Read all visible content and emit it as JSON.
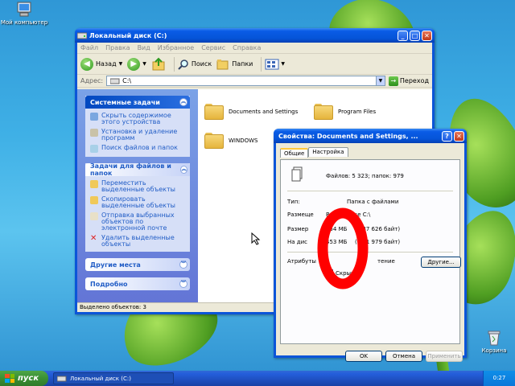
{
  "desktop": {
    "my_computer_label": "Мой компьютер",
    "recycle_bin_label": "Корзина"
  },
  "explorer": {
    "title": "Локальный диск (C:)",
    "menu": [
      "Файл",
      "Правка",
      "Вид",
      "Избранное",
      "Сервис",
      "Справка"
    ],
    "toolbar": {
      "back": "Назад",
      "search": "Поиск",
      "folders": "Папки"
    },
    "address_label": "Адрес:",
    "address_value": "C:\\",
    "go_label": "Переход",
    "system_tasks": {
      "title": "Системные задачи",
      "items": [
        "Скрыть содержимое этого устройства",
        "Установка и удаление программ",
        "Поиск файлов и папок"
      ]
    },
    "file_tasks": {
      "title": "Задачи для файлов и папок",
      "items": [
        "Переместить выделенные объекты",
        "Скопировать выделенные объекты",
        "Отправка выбранных объектов по электронной почте",
        "Удалить выделенные объекты"
      ]
    },
    "other_places": "Другие места",
    "details": "Подробно",
    "folders": [
      "Documents and Settings",
      "Program Files",
      "WINDOWS"
    ],
    "status": "Выделено объектов: 3"
  },
  "dialog": {
    "title": "Свойства: Documents and Settings, ...",
    "tabs": [
      "Общие",
      "Настройка"
    ],
    "files_summary": "Файлов: 5 323; папок: 979",
    "type_label": "Тип:",
    "type_value": "Папка с файлами",
    "location_label": "Размеще",
    "location_value": "Все в папке C:\\",
    "size_label": "Размер",
    "size_value": "454 МБ",
    "size_bytes": "(   787 626 байт)",
    "disk_label": "На дис",
    "disk_value": "453 МБ",
    "disk_bytes": "(   781 979 байт)",
    "attributes_label": "Атрибуты",
    "readonly_label": "тение",
    "hidden_label": "Скрытый",
    "other_button": "Другие...",
    "ok": "OK",
    "cancel": "Отмена",
    "apply": "Применить",
    "help_button": "?",
    "close_button": "✕"
  },
  "taskbar": {
    "start": "пуск",
    "task": "Локальный диск (C:)",
    "clock": "0:27"
  },
  "colors": {
    "annotation_ring": "#ff0000",
    "xp_blue": "#0b55d8",
    "link_blue": "#215dc6"
  }
}
